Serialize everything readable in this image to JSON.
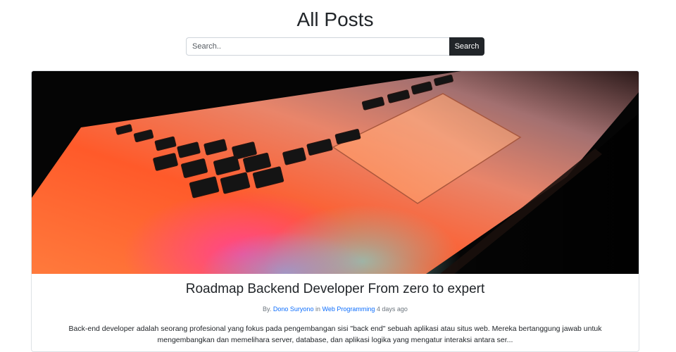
{
  "page": {
    "title": "All Posts"
  },
  "search": {
    "placeholder": "Search..",
    "value": "",
    "button_label": "Search"
  },
  "post": {
    "image_alt": "",
    "title": "Roadmap Backend Developer From zero to expert",
    "meta": {
      "by_label": "By.",
      "author": "Dono Suryono",
      "in_label": "in",
      "category": "Web Programming",
      "time": "4 days ago"
    },
    "excerpt": "Back-end developer adalah seorang profesional yang fokus pada pengembangan sisi \"back end\" sebuah aplikasi atau situs web. Mereka bertanggung jawab untuk mengembangkan dan memelihara server, database, dan aplikasi logika yang mengatur interaksi antara ser..."
  },
  "colors": {
    "button_dark": "#212529",
    "link_blue": "#0d6efd",
    "meta_gray": "#6c757d"
  }
}
